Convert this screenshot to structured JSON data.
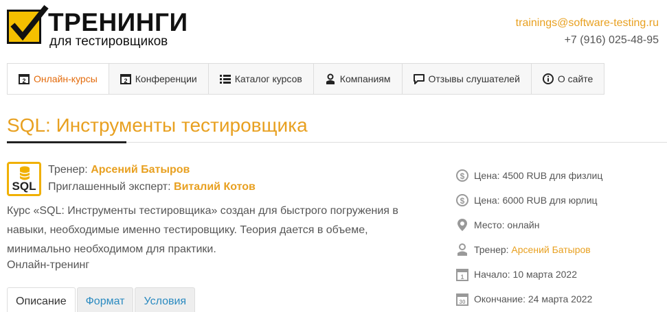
{
  "header": {
    "logo_title": "ТРЕНИНГИ",
    "logo_subtitle": "для тестировщиков",
    "email": "trainings@software-testing.ru",
    "phone": "+7 (916) 025-48-95"
  },
  "nav": {
    "items": [
      {
        "label": "Онлайн-курсы",
        "icon": "calendar-icon",
        "active": true
      },
      {
        "label": "Конференции",
        "icon": "calendar-icon",
        "active": false
      },
      {
        "label": "Каталог курсов",
        "icon": "list-icon",
        "active": false
      },
      {
        "label": "Компаниям",
        "icon": "user-icon",
        "active": false
      },
      {
        "label": "Отзывы слушателей",
        "icon": "comment-icon",
        "active": false
      },
      {
        "label": "О сайте",
        "icon": "info-icon",
        "active": false
      }
    ]
  },
  "course": {
    "title": "SQL: Инструменты тестировщика",
    "icon_text": "SQL",
    "trainer_label": "Тренер:",
    "trainer_name": "Арсений Батыров",
    "expert_label": "Приглашенный эксперт:",
    "expert_name": "Виталий Котов",
    "description": "Курс «SQL: Инструменты тестировщика» создан для быстрого погружения в навыки, необходимые именно тестировщику. Теория дается в объеме, минимально необходимом для практики.",
    "format": "Онлайн-тренинг"
  },
  "tabs": [
    {
      "label": "Описание",
      "active": true
    },
    {
      "label": "Формат",
      "active": false
    },
    {
      "label": "Условия",
      "active": false
    }
  ],
  "info": {
    "price_individual": "Цена: 4500 RUB для физлиц",
    "price_company": "Цена: 6000 RUB для юрлиц",
    "place": "Место: онлайн",
    "trainer_label": "Тренер:",
    "trainer_name": "Арсений Батыров",
    "start": "Начало: 10 марта 2022",
    "end": "Окончание: 24 марта 2022"
  },
  "colors": {
    "accent": "#e8a020",
    "nav_active": "#e36a0a",
    "tab_link": "#2a8ac0",
    "logo_yellow": "#f5c000"
  }
}
